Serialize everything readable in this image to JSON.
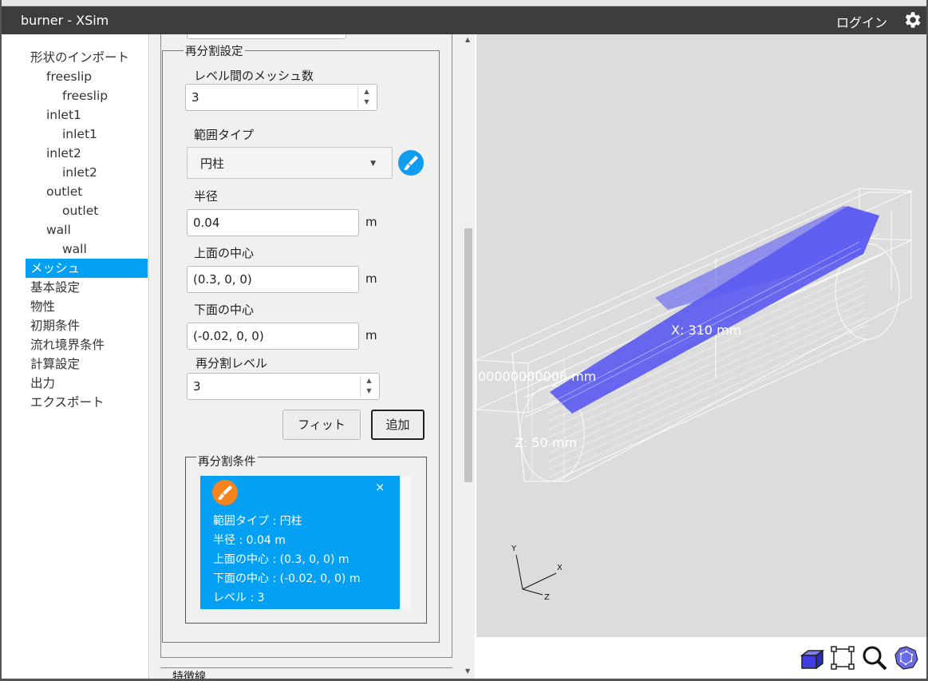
{
  "window": {
    "title": "burner - XSim",
    "login_label": "ログイン"
  },
  "sidebar": {
    "items": [
      {
        "label": "形状のインポート",
        "level": 0
      },
      {
        "label": "freeslip",
        "level": 1
      },
      {
        "label": "freeslip",
        "level": 2
      },
      {
        "label": "inlet1",
        "level": 1
      },
      {
        "label": "inlet1",
        "level": 2
      },
      {
        "label": "inlet2",
        "level": 1
      },
      {
        "label": "inlet2",
        "level": 2
      },
      {
        "label": "outlet",
        "level": 1
      },
      {
        "label": "outlet",
        "level": 2
      },
      {
        "label": "wall",
        "level": 1
      },
      {
        "label": "wall",
        "level": 2
      },
      {
        "label": "メッシュ",
        "level": 0,
        "active": true
      },
      {
        "label": "基本設定",
        "level": 0
      },
      {
        "label": "物性",
        "level": 0
      },
      {
        "label": "初期条件",
        "level": 0
      },
      {
        "label": "流れ境界条件",
        "level": 0
      },
      {
        "label": "計算設定",
        "level": 0
      },
      {
        "label": "出力",
        "level": 0
      },
      {
        "label": "エクスポート",
        "level": 0
      }
    ]
  },
  "refine": {
    "legend": "再分割設定",
    "mesh_count_label": "レベル間のメッシュ数",
    "mesh_count_value": "3",
    "range_type_label": "範囲タイプ",
    "range_type_value": "円柱",
    "radius_label": "半径",
    "radius_value": "0.04",
    "radius_unit": "m",
    "top_center_label": "上面の中心",
    "top_center_value": "(0.3, 0, 0)",
    "top_center_unit": "m",
    "bottom_center_label": "下面の中心",
    "bottom_center_value": "(-0.02, 0, 0)",
    "bottom_center_unit": "m",
    "level_label": "再分割レベル",
    "level_value": "3",
    "fit_button": "フィット",
    "add_button": "追加"
  },
  "conditions": {
    "legend": "再分割条件",
    "close_symbol": "×",
    "lines": [
      "範囲タイプ : 円柱",
      "半径 : 0.04 m",
      "上面の中心 : (0.3, 0, 0) m",
      "下面の中心 : (-0.02, 0, 0) m",
      "レベル : 3"
    ]
  },
  "next_section_legend": "特徴線",
  "viewport": {
    "dim_x": "X: 310 mm",
    "dim_y": "00000000006 mm",
    "dim_z": "Z: 50 mm",
    "axis_x": "X",
    "axis_y": "Y",
    "axis_z": "Z",
    "colors": {
      "background": "#dcdcdc",
      "cylinder": "#4a4af0",
      "wire": "#ffffff"
    }
  },
  "toolbar": {
    "icons": [
      "box-view-icon",
      "fit-frame-icon",
      "zoom-icon",
      "sphere-view-icon"
    ]
  },
  "colors": {
    "accent": "#03a0f4",
    "titlebar": "#3d3d3d",
    "orange": "#f5841f"
  }
}
